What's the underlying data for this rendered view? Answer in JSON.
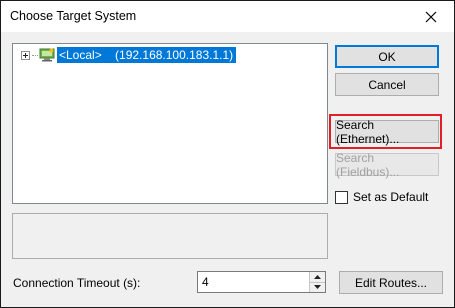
{
  "window": {
    "title": "Choose Target System"
  },
  "tree": {
    "nodes": [
      {
        "label": "<Local>    (192.168.100.183.1.1)",
        "selected": true
      }
    ]
  },
  "buttons": {
    "ok": "OK",
    "cancel": "Cancel",
    "search_ethernet": "Search (Ethernet)...",
    "search_fieldbus": "Search (Fieldbus)...",
    "edit_routes": "Edit Routes..."
  },
  "checkbox": {
    "set_default_label": "Set as Default",
    "checked": false
  },
  "timeout": {
    "label": "Connection Timeout (s):",
    "value": "4"
  },
  "colors": {
    "selection": "#0078d7",
    "highlight_outline": "#e21e26"
  },
  "icons": {
    "close": "close-icon",
    "tree_expander": "plus-expander-icon",
    "node": "target-computer-icon",
    "spin_up": "chevron-up-icon",
    "spin_down": "chevron-down-icon"
  }
}
